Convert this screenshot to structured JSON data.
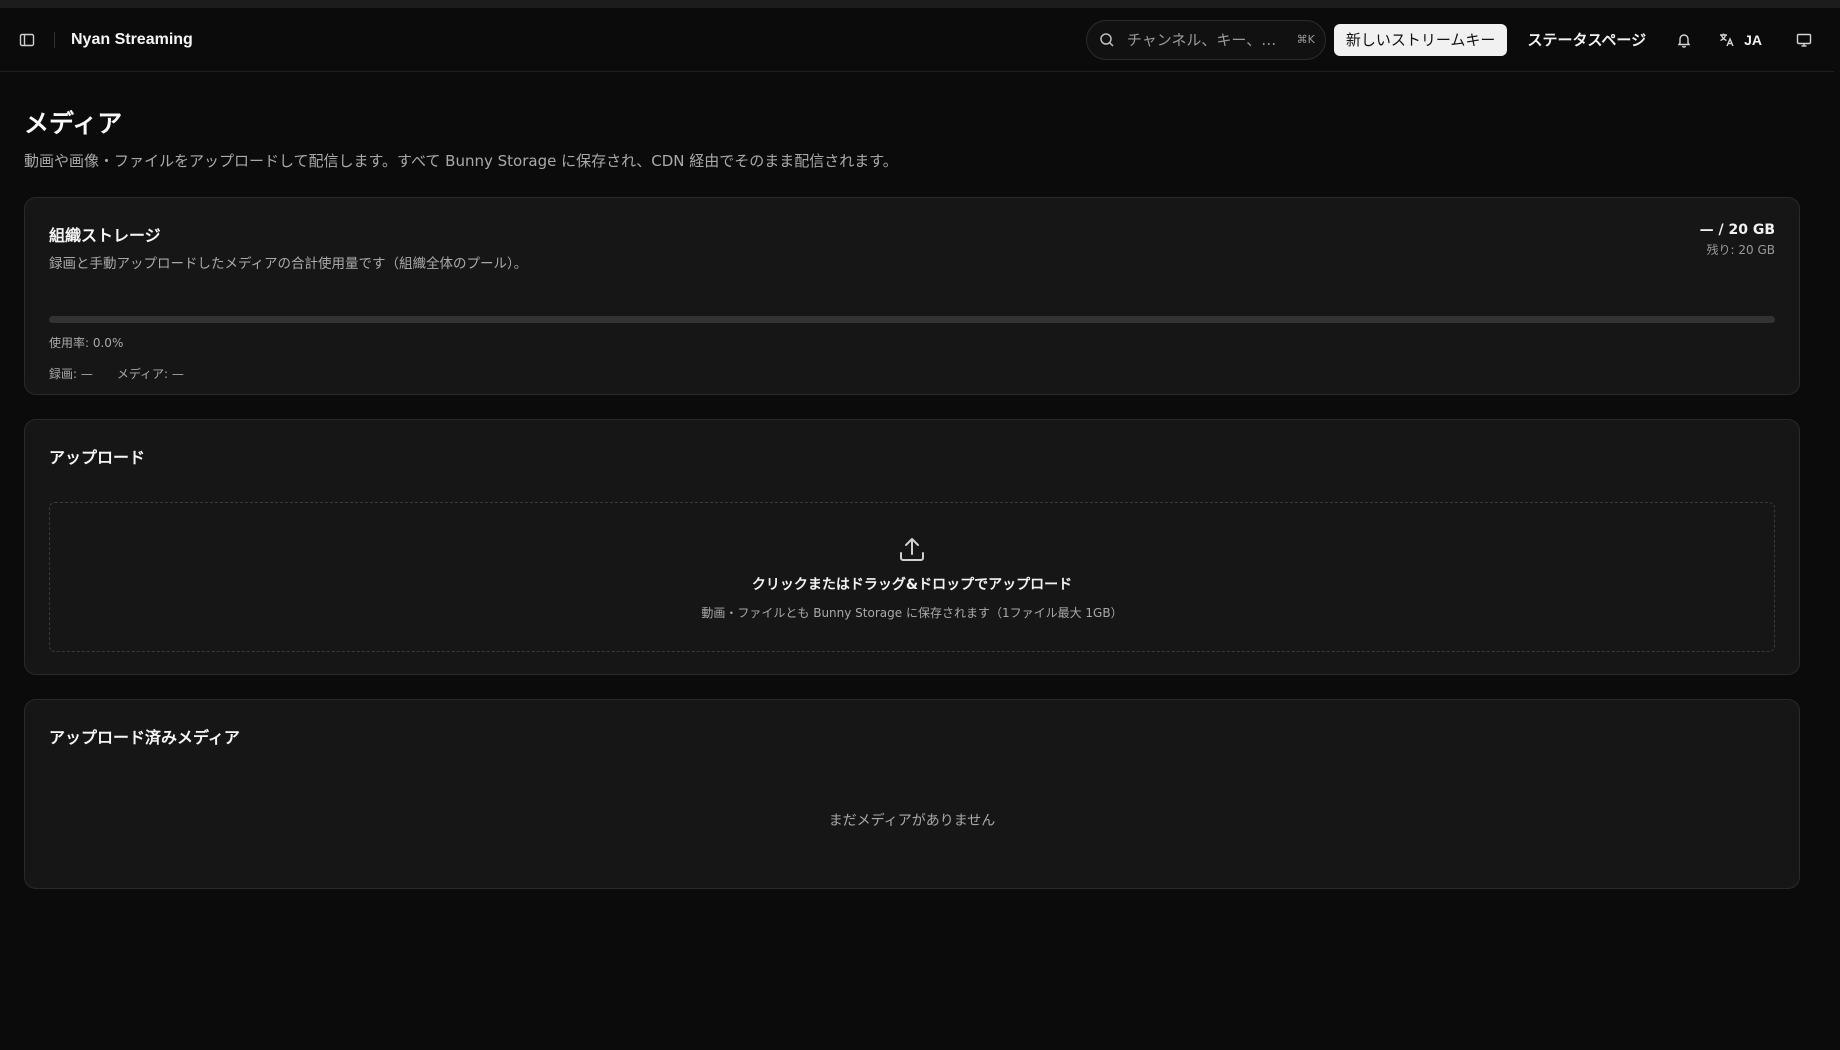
{
  "header": {
    "app_title": "Nyan Streaming",
    "search_placeholder": "チャンネル、キー、ま…",
    "search_shortcut": "⌘K",
    "new_stream_key_label": "新しいストリームキー",
    "status_page_label": "ステータスページ",
    "language_label": "JA",
    "icons": [
      "sidebar-toggle-icon",
      "search-icon",
      "bell-icon",
      "translate-icon",
      "monitor-icon"
    ]
  },
  "page": {
    "title": "メディア",
    "description": "動画や画像・ファイルをアップロードして配信します。すべて Bunny Storage に保存され、CDN 経由でそのまま配信されます。"
  },
  "storage": {
    "title": "組織ストレージ",
    "subtitle": "録画と手動アップロードしたメディアの合計使用量です（組織全体のプール）。",
    "amount_total": "— / 20 GB",
    "amount_remaining": "残り: 20 GB",
    "usage_fraction": 0.0,
    "usage_rate": "使用率: 0.0%",
    "recordings": "録画: —",
    "media": "メディア: —"
  },
  "upload": {
    "title": "アップロード",
    "drop_title": "クリックまたはドラッグ&ドロップでアップロード",
    "drop_sub": "動画・ファイルとも Bunny Storage に保存されます（1ファイル最大 1GB）"
  },
  "media_list": {
    "title": "アップロード済みメディア",
    "empty": "まだメディアがありません"
  }
}
